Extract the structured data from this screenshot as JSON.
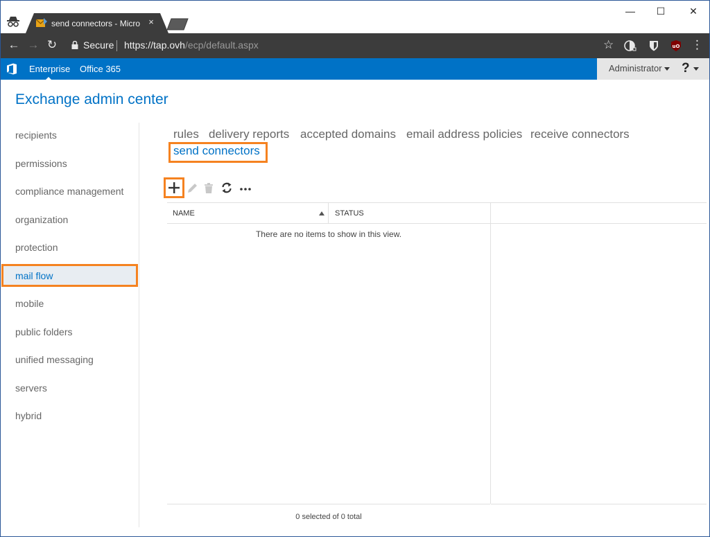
{
  "browser": {
    "tab_title": "send connectors - Micro",
    "tab_close": "×",
    "window_controls": {
      "minimize": "—",
      "maximize": "☐",
      "close": "✕"
    },
    "nav": {
      "back": "←",
      "forward": "→",
      "reload": "↻"
    },
    "secure_label": "Secure",
    "url_host": "https://tap.ovh",
    "url_path": "/ecp/default.aspx",
    "star": "☆",
    "menu": "⋮",
    "extensions": [
      "dark-reader-icon",
      "bitwarden-icon",
      "ublock-icon"
    ]
  },
  "o365": {
    "links": [
      "Enterprise",
      "Office 365"
    ],
    "admin": "Administrator",
    "help": "?"
  },
  "app": {
    "title": "Exchange admin center"
  },
  "sidebar": {
    "items": [
      "recipients",
      "permissions",
      "compliance management",
      "organization",
      "protection",
      "mail flow",
      "mobile",
      "public folders",
      "unified messaging",
      "servers",
      "hybrid"
    ],
    "active_index": 5
  },
  "subtabs": {
    "items": [
      "rules",
      "delivery reports",
      "accepted domains",
      "email address policies",
      "receive connectors",
      "send connectors"
    ],
    "active_index": 5
  },
  "toolbar": {
    "buttons": [
      "add-icon",
      "edit-icon",
      "delete-icon",
      "refresh-icon",
      "more-icon"
    ]
  },
  "list": {
    "columns": [
      "NAME",
      "STATUS"
    ],
    "sort_column": "NAME",
    "sort_direction": "ascending",
    "empty_message": "There are no items to show in this view.",
    "footer": "0 selected of 0 total"
  },
  "colors": {
    "accent": "#0072c6",
    "highlight": "#f58220",
    "browser_chrome": "#3c3c3c"
  }
}
